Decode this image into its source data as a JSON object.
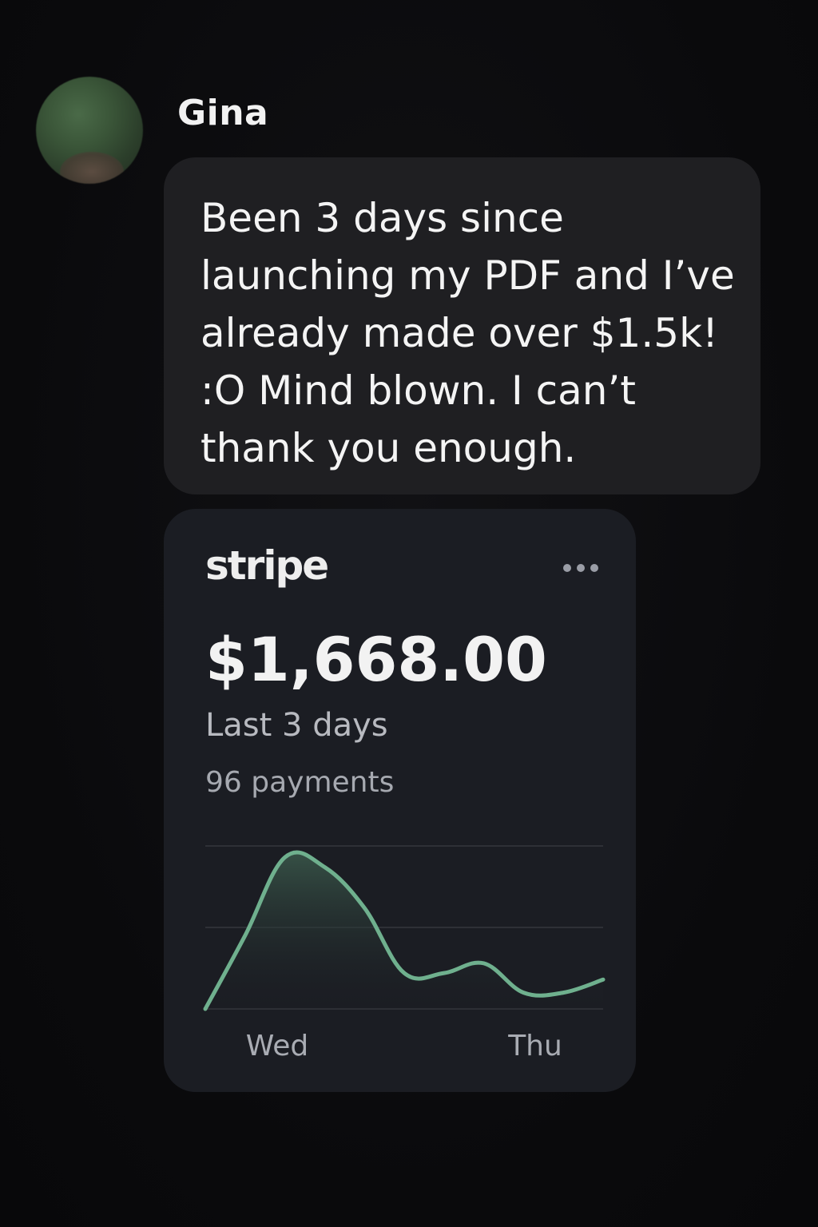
{
  "message": {
    "sender_name": "Gina",
    "text": "Been 3 days since launching my PDF and I’ve already made over $1.5k! :O Mind blown. I can’t thank you enough."
  },
  "stripe_card": {
    "brand": "stripe",
    "amount": "$1,668.00",
    "period_label": "Last 3 days",
    "payments_label": "96 payments",
    "colors": {
      "line": "#6fb08e",
      "card_bg": "#1b1d23"
    }
  },
  "chart_data": {
    "type": "area",
    "x_ticks": [
      "Wed",
      "Thu"
    ],
    "series": [
      {
        "values": [
          0.0,
          0.45,
          0.93,
          0.87,
          0.62,
          0.22,
          0.22,
          0.28,
          0.1,
          0.1,
          0.18
        ]
      }
    ],
    "ylim": [
      0,
      1
    ],
    "grid": true
  }
}
